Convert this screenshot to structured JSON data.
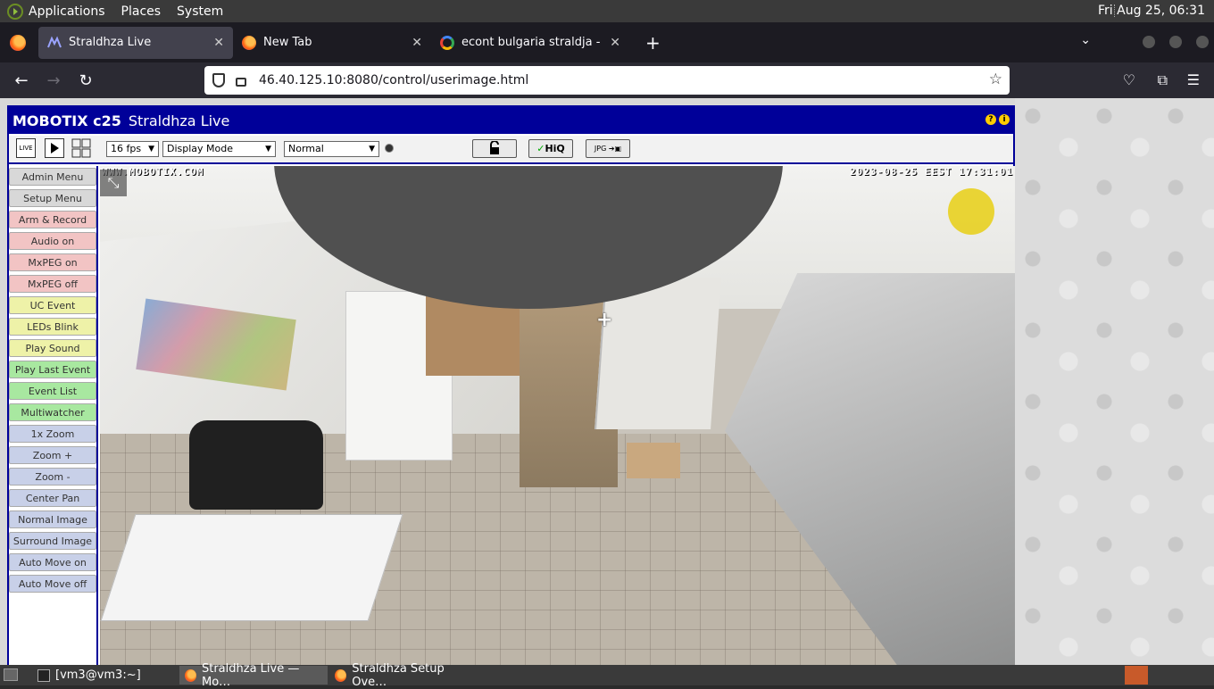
{
  "top_panel": {
    "menus": [
      "Applications",
      "Places",
      "System"
    ],
    "clock": "Fri Aug 25, 06:31"
  },
  "tabs": [
    {
      "label": "Straldhza Live",
      "icon": "mobotix-icon",
      "active": true
    },
    {
      "label": "New Tab",
      "icon": "firefox-icon",
      "active": false
    },
    {
      "label": "econt bulgaria straldja - Goo",
      "icon": "google-icon",
      "active": false
    }
  ],
  "navbar": {
    "url": "46.40.125.10:8080/control/userimage.html"
  },
  "mobotix": {
    "brand": "MOBOTIX c25",
    "page_title": "Straldhza Live",
    "toolbar": {
      "live_label": "LIVE",
      "fps": "16 fps",
      "display_mode": "Display Mode",
      "image_mode": "Normal",
      "hiq_label": "HiQ",
      "jpg_label": "JPG"
    },
    "side_buttons": [
      {
        "label": "Admin Menu",
        "color": "#d8d8d8"
      },
      {
        "label": "Setup Menu",
        "color": "#d8d8d8"
      },
      {
        "label": "Arm & Record",
        "color": "#f2c4c4"
      },
      {
        "label": "Audio on",
        "color": "#f2c4c4"
      },
      {
        "label": "MxPEG on",
        "color": "#f2c4c4"
      },
      {
        "label": "MxPEG off",
        "color": "#f2c4c4"
      },
      {
        "label": "UC Event",
        "color": "#eef2a8"
      },
      {
        "label": "LEDs Blink",
        "color": "#eef2a8"
      },
      {
        "label": "Play Sound",
        "color": "#eef2a8"
      },
      {
        "label": "Play Last Event",
        "color": "#a8e8a0"
      },
      {
        "label": "Event List",
        "color": "#a8e8a0"
      },
      {
        "label": "Multiwatcher",
        "color": "#a8e8a0"
      },
      {
        "label": "1x Zoom",
        "color": "#c8d0e8"
      },
      {
        "label": "Zoom +",
        "color": "#c8d0e8"
      },
      {
        "label": "Zoom -",
        "color": "#c8d0e8"
      },
      {
        "label": "Center Pan",
        "color": "#c8d0e8"
      },
      {
        "label": "Normal Image",
        "color": "#c8d0e8"
      },
      {
        "label": "Surround Image",
        "color": "#c8d0e8"
      },
      {
        "label": "Auto Move on",
        "color": "#c8d0e8"
      },
      {
        "label": "Auto Move off",
        "color": "#c8d0e8"
      }
    ],
    "osd": {
      "left": "WWW.MOBOTIX.COM",
      "right": "2023-08-25 EEST 17:31:01"
    }
  },
  "taskbar": {
    "items": [
      {
        "label": "[vm3@vm3:~]",
        "icon": "terminal-icon",
        "active": false
      },
      {
        "label": "Straldhza Live — Mo…",
        "icon": "firefox-icon",
        "active": true
      },
      {
        "label": "Straldhza Setup Ove…",
        "icon": "firefox-icon",
        "active": false
      }
    ]
  },
  "colors": {
    "mobotix_blue": "#000099",
    "panel_bg": "#3a3a3a",
    "firefox_tabstrip": "#1c1b22"
  }
}
